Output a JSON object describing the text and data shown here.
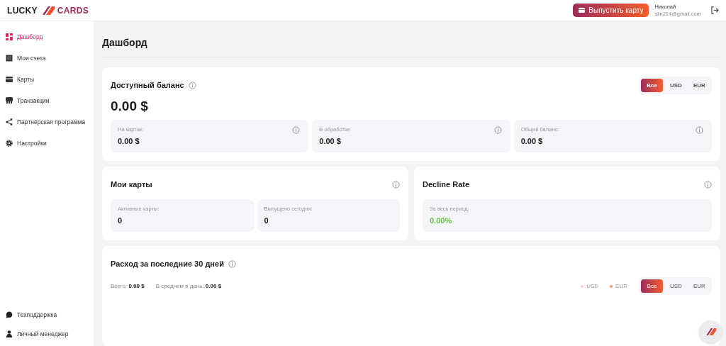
{
  "header": {
    "logo_left": "LUCKY",
    "logo_right": "CARDS",
    "issue_button": "Выпустить карту",
    "user": {
      "name": "Николай",
      "email": "slin214@gmail.com"
    }
  },
  "sidebar": {
    "items": [
      {
        "label": "Дашборд",
        "kind": "dashboard",
        "selected": true
      },
      {
        "label": "Мои счета",
        "kind": "accounts",
        "selected": false
      },
      {
        "label": "Карты",
        "kind": "card",
        "selected": false
      },
      {
        "label": "Транзакции",
        "kind": "transactions",
        "selected": false
      },
      {
        "label": "Партнёрская программа",
        "kind": "share",
        "selected": false
      },
      {
        "label": "Настройки",
        "kind": "gear",
        "selected": false
      }
    ],
    "bottom_items": [
      {
        "label": "Техподдержка",
        "kind": "chat"
      },
      {
        "label": "Личный менеджер",
        "kind": "person"
      }
    ]
  },
  "page_title": "Дашборд",
  "balance": {
    "title": "Доступный баланс",
    "total": "0.00 $",
    "currency_tabs": [
      {
        "label": "Все",
        "selected": true
      },
      {
        "label": "USD",
        "selected": false
      },
      {
        "label": "EUR",
        "selected": false
      }
    ],
    "stats": [
      {
        "label": "На картах:",
        "value": "0.00 $"
      },
      {
        "label": "В обработке:",
        "value": "0.00 $"
      },
      {
        "label": "Общий баланс:",
        "value": "0.00 $"
      }
    ]
  },
  "my_cards": {
    "title": "Мои карты",
    "stats": [
      {
        "label": "Активные карты:",
        "value": "0"
      },
      {
        "label": "Выпущено сегодня:",
        "value": "0"
      }
    ]
  },
  "decline_rate": {
    "title": "Decline Rate",
    "stats": [
      {
        "label": "За весь период:",
        "value": "0.00%"
      }
    ]
  },
  "spending": {
    "title": "Расход за последние 30 дней",
    "total_label": "Всего:",
    "total_value": "0.00 $",
    "avg_label": "В среднем в день:",
    "avg_value": "0.00 $",
    "legend": [
      {
        "label": "USD",
        "color": "#f8c9bc"
      },
      {
        "label": "EUR",
        "color": "#f59a6c"
      }
    ],
    "currency_tabs": [
      {
        "label": "Все",
        "selected": true
      },
      {
        "label": "USD",
        "selected": false
      },
      {
        "label": "EUR",
        "selected": false
      }
    ]
  }
}
